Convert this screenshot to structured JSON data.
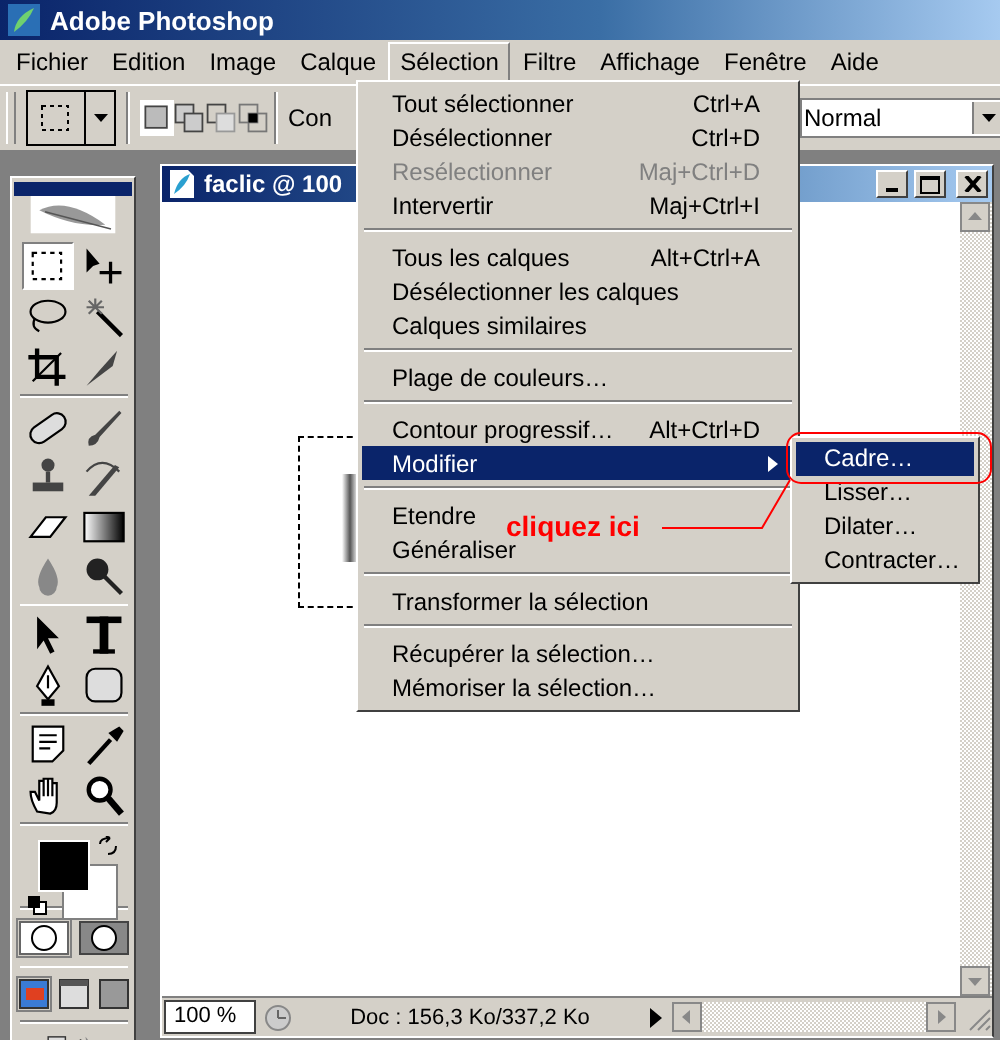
{
  "window": {
    "title": "Adobe Photoshop"
  },
  "menu_bar": [
    {
      "label": "Fichier",
      "selected": false
    },
    {
      "label": "Edition",
      "selected": false
    },
    {
      "label": "Image",
      "selected": false
    },
    {
      "label": "Calque",
      "selected": false
    },
    {
      "label": "Sélection",
      "selected": true
    },
    {
      "label": "Filtre",
      "selected": false
    },
    {
      "label": "Affichage",
      "selected": false
    },
    {
      "label": "Fenêtre",
      "selected": false
    },
    {
      "label": "Aide",
      "selected": false
    }
  ],
  "options_bar": {
    "label": "Con",
    "mode": "Normal",
    "selection_modes": [
      {
        "kind": "new",
        "selected": true
      },
      {
        "kind": "add",
        "selected": false
      },
      {
        "kind": "subtract",
        "selected": false
      },
      {
        "kind": "intersect",
        "selected": false
      }
    ]
  },
  "toolbox": {
    "groups": [
      [
        {
          "kind": "marquee",
          "selected": true
        },
        {
          "kind": "move",
          "selected": false
        },
        {
          "kind": "lasso",
          "selected": false
        },
        {
          "kind": "wand",
          "selected": false
        },
        {
          "kind": "crop",
          "selected": false
        },
        {
          "kind": "slice",
          "selected": false
        }
      ],
      [
        {
          "kind": "heal",
          "selected": false
        },
        {
          "kind": "brush",
          "selected": false
        },
        {
          "kind": "stamp",
          "selected": false
        },
        {
          "kind": "history",
          "selected": false
        },
        {
          "kind": "eraser",
          "selected": false
        },
        {
          "kind": "gradient",
          "selected": false
        },
        {
          "kind": "blur",
          "selected": false
        },
        {
          "kind": "dodge",
          "selected": false
        }
      ],
      [
        {
          "kind": "path",
          "selected": false
        },
        {
          "kind": "type",
          "selected": false
        },
        {
          "kind": "pen",
          "selected": false
        },
        {
          "kind": "shape",
          "selected": false
        }
      ],
      [
        {
          "kind": "notes",
          "selected": false
        },
        {
          "kind": "eyedropper",
          "selected": false
        },
        {
          "kind": "hand",
          "selected": false
        },
        {
          "kind": "zoom",
          "selected": false
        }
      ]
    ],
    "mask_modes": [
      {
        "kind": "standard",
        "selected": true
      },
      {
        "kind": "quick",
        "selected": false
      }
    ],
    "screen_modes": [
      {
        "kind": "standard",
        "selected": true
      },
      {
        "kind": "menu",
        "selected": false
      },
      {
        "kind": "full",
        "selected": false
      }
    ]
  },
  "document": {
    "title": "faclic @ 100",
    "zoom": "100 %",
    "status": "Doc : 156,3 Ko/337,2 Ko"
  },
  "selection_menu": [
    [
      {
        "label": "Tout sélectionner",
        "shortcut": "Ctrl+A",
        "disabled": false,
        "selected": false,
        "submenu": false
      },
      {
        "label": "Désélectionner",
        "shortcut": "Ctrl+D",
        "disabled": false,
        "selected": false,
        "submenu": false
      },
      {
        "label": "Resélectionner",
        "shortcut": "Maj+Ctrl+D",
        "disabled": true,
        "selected": false,
        "submenu": false
      },
      {
        "label": "Intervertir",
        "shortcut": "Maj+Ctrl+I",
        "disabled": false,
        "selected": false,
        "submenu": false
      }
    ],
    [
      {
        "label": "Tous les calques",
        "shortcut": "Alt+Ctrl+A",
        "disabled": false,
        "selected": false,
        "submenu": false
      },
      {
        "label": "Désélectionner les calques",
        "disabled": false,
        "selected": false,
        "submenu": false
      },
      {
        "label": "Calques similaires",
        "disabled": false,
        "selected": false,
        "submenu": false
      }
    ],
    [
      {
        "label": "Plage de couleurs…",
        "disabled": false,
        "selected": false,
        "submenu": false
      }
    ],
    [
      {
        "label": "Contour progressif…",
        "shortcut": "Alt+Ctrl+D",
        "disabled": false,
        "selected": false,
        "submenu": false
      },
      {
        "label": "Modifier",
        "disabled": false,
        "selected": true,
        "submenu": true
      }
    ],
    [
      {
        "label": "Etendre",
        "disabled": false,
        "selected": false,
        "submenu": false
      },
      {
        "label": "Généraliser",
        "disabled": false,
        "selected": false,
        "submenu": false
      }
    ],
    [
      {
        "label": "Transformer la sélection",
        "disabled": false,
        "selected": false,
        "submenu": false
      }
    ],
    [
      {
        "label": "Récupérer la sélection…",
        "disabled": false,
        "selected": false,
        "submenu": false
      },
      {
        "label": "Mémoriser la sélection…",
        "disabled": false,
        "selected": false,
        "submenu": false
      }
    ]
  ],
  "submenu": [
    {
      "label": "Cadre…",
      "selected": true
    },
    {
      "label": "Lisser…",
      "selected": false
    },
    {
      "label": "Dilater…",
      "selected": false
    },
    {
      "label": "Contracter…",
      "selected": false
    }
  ],
  "annotation": {
    "text": "cliquez ici"
  }
}
